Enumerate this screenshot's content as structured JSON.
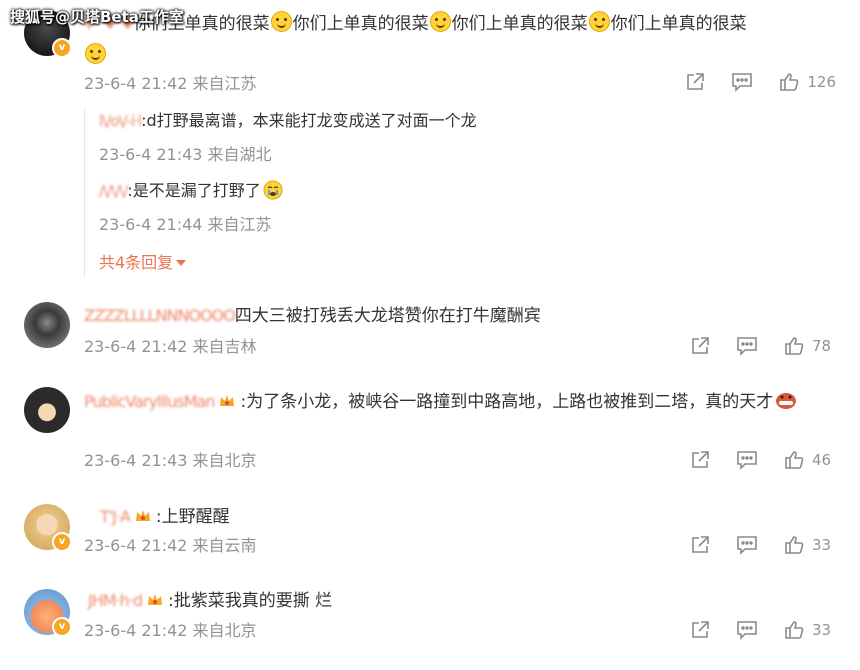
{
  "watermark": "搜狐号@贝塔Beta工作室",
  "comments": [
    {
      "username": "¥ᵒ ♥ ♥",
      "text_parts": [
        "你们上单真的很菜",
        "你们上单真的很菜",
        "你们上单真的很菜",
        "你们上单真的很菜"
      ],
      "time": "23-6-4 21:42 来自江苏",
      "likes": "126",
      "replies": [
        {
          "username": "l\\/o\\/-i·l",
          "text": ":d打野最离谱，本来能打龙变成送了对面一个龙",
          "time": "23-6-4 21:43 来自湖北"
        },
        {
          "username": "/\\/\\/\\/",
          "text": ":是不是漏了打野了",
          "time": "23-6-4 21:44 来自江苏"
        }
      ],
      "more_label": "共4条回复"
    },
    {
      "username": "ZZZZLLLLNNNOOOO",
      "text": "四大三被打残丢大龙塔赞你在打牛魔酬宾",
      "time": "23-6-4 21:42 来自吉林",
      "likes": "78"
    },
    {
      "username": "PublicVarylllusMan",
      "text": ":为了条小龙，被峡谷一路撞到中路高地，上路也被推到二塔，真的天才",
      "time": "23-6-4 21:43 来自北京",
      "likes": "46"
    },
    {
      "username": "T'J·A",
      "text": ":上野醒醒",
      "time": "23-6-4 21:42 来自云南",
      "likes": "33"
    },
    {
      "username": "JHM·h·d",
      "text": ":批紫菜我真的要撕 烂",
      "time": "23-6-4 21:42 来自北京",
      "likes": "33"
    }
  ]
}
